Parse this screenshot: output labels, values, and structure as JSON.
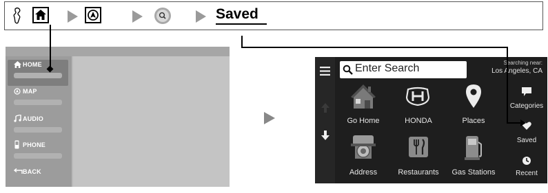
{
  "breadcrumb": {
    "saved_label": "Saved",
    "icons": [
      "voice-icon",
      "home-icon",
      "navigation-icon",
      "search-icon"
    ]
  },
  "home_menu": {
    "items": [
      "HOME",
      "MAP",
      "AUDIO",
      "PHONE",
      "BACK"
    ]
  },
  "nav_screen": {
    "search_placeholder": "Enter Search",
    "searching_near_label": "Searching near:",
    "location": "Los Angeles, CA",
    "tiles": [
      "Go Home",
      "HONDA",
      "Places",
      "Address",
      "Restaurants",
      "Gas Stations"
    ],
    "side_items": [
      "Categories",
      "Saved",
      "Recent"
    ]
  },
  "colors": {
    "screen_bg": "#1e1e1e",
    "panel_bg": "#b9b9b9",
    "arrow_gray": "#9a9a9a"
  }
}
